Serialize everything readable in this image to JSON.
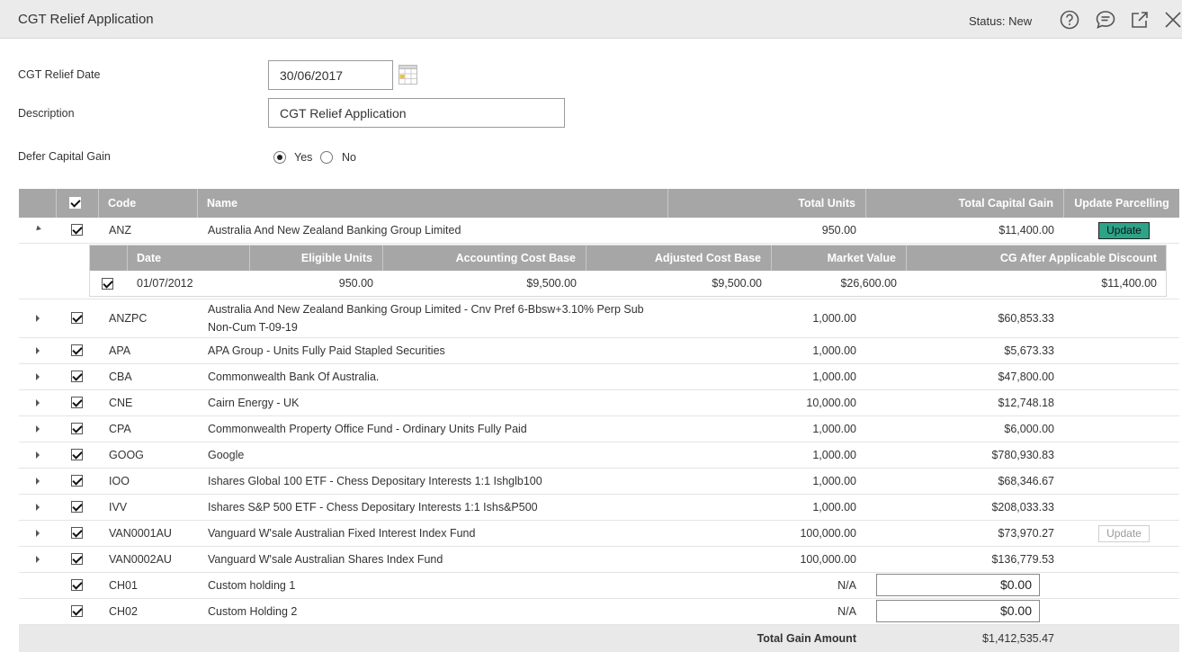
{
  "window": {
    "title": "CGT Relief Application",
    "status": "Status: New"
  },
  "icons": {
    "help": "help-icon",
    "comment": "comment-icon",
    "popout": "popout-icon",
    "close": "close-icon",
    "calendar": "calendar-icon"
  },
  "form": {
    "date_label": "CGT Relief Date",
    "date_value": "30/06/2017",
    "description_label": "Description",
    "description_value": "CGT Relief Application",
    "defer_label": "Defer Capital Gain",
    "yes_label": "Yes",
    "no_label": "No",
    "defer_selected": "Yes"
  },
  "grid": {
    "headers": {
      "code": "Code",
      "name": "Name",
      "total_units": "Total Units",
      "total_capital_gain": "Total Capital Gain",
      "update_parcelling": "Update Parcelling"
    },
    "update_label": "Update",
    "rows": [
      {
        "code": "ANZ",
        "name_line1": "Australia And New Zealand Banking Group Limited",
        "name_line2": "",
        "units": "950.00",
        "gain": "$11,400.00"
      },
      {
        "code": "ANZPC",
        "name_line1": "Australia And New Zealand Banking Group Limited - Cnv Pref 6-Bbsw+3.10% Perp Sub",
        "name_line2": "Non-Cum T-09-19",
        "units": "1,000.00",
        "gain": "$60,853.33"
      },
      {
        "code": "APA",
        "name_line1": "APA Group - Units Fully Paid Stapled Securities",
        "name_line2": "",
        "units": "1,000.00",
        "gain": "$5,673.33"
      },
      {
        "code": "CBA",
        "name_line1": "Commonwealth Bank Of Australia.",
        "name_line2": "",
        "units": "1,000.00",
        "gain": "$47,800.00"
      },
      {
        "code": "CNE",
        "name_line1": "Cairn Energy - UK",
        "name_line2": "",
        "units": "10,000.00",
        "gain": "$12,748.18"
      },
      {
        "code": "CPA",
        "name_line1": "Commonwealth Property Office Fund - Ordinary Units Fully Paid",
        "name_line2": "",
        "units": "1,000.00",
        "gain": "$6,000.00"
      },
      {
        "code": "GOOG",
        "name_line1": "Google",
        "name_line2": "",
        "units": "1,000.00",
        "gain": "$780,930.83"
      },
      {
        "code": "IOO",
        "name_line1": "Ishares Global 100 ETF - Chess Depositary Interests 1:1 Ishglb100",
        "name_line2": "",
        "units": "1,000.00",
        "gain": "$68,346.67"
      },
      {
        "code": "IVV",
        "name_line1": "Ishares S&P 500 ETF - Chess Depositary Interests 1:1 Ishs&P500",
        "name_line2": "",
        "units": "1,000.00",
        "gain": "$208,033.33"
      },
      {
        "code": "VAN0001AU",
        "name_line1": "Vanguard W'sale Australian Fixed Interest Index Fund",
        "name_line2": "",
        "units": "100,000.00",
        "gain": "$73,970.27"
      },
      {
        "code": "VAN0002AU",
        "name_line1": "Vanguard W'sale Australian Shares Index Fund",
        "name_line2": "",
        "units": "100,000.00",
        "gain": "$136,779.53"
      },
      {
        "code": "CH01",
        "name_line1": "Custom holding 1",
        "name_line2": "",
        "units": "N/A",
        "gain": "$0.00"
      },
      {
        "code": "CH02",
        "name_line1": "Custom Holding 2",
        "name_line2": "",
        "units": "N/A",
        "gain": "$0.00"
      }
    ],
    "subgrid": {
      "headers": {
        "date": "Date",
        "eligible_units": "Eligible Units",
        "accounting_cost_base": "Accounting Cost Base",
        "adjusted_cost_base": "Adjusted Cost Base",
        "market_value": "Market Value",
        "cg_after_discount": "CG After Applicable Discount"
      },
      "row": {
        "date": "01/07/2012",
        "eligible_units": "950.00",
        "accounting_cost_base": "$9,500.00",
        "adjusted_cost_base": "$9,500.00",
        "market_value": "$26,600.00",
        "cg_after_discount": "$11,400.00"
      }
    },
    "total_label": "Total Gain Amount",
    "total_value": "$1,412,535.47"
  },
  "colors": {
    "header_bg": "#a6a6a6",
    "update_button": "#2ba488",
    "titlebar_bg": "#ebebeb"
  }
}
